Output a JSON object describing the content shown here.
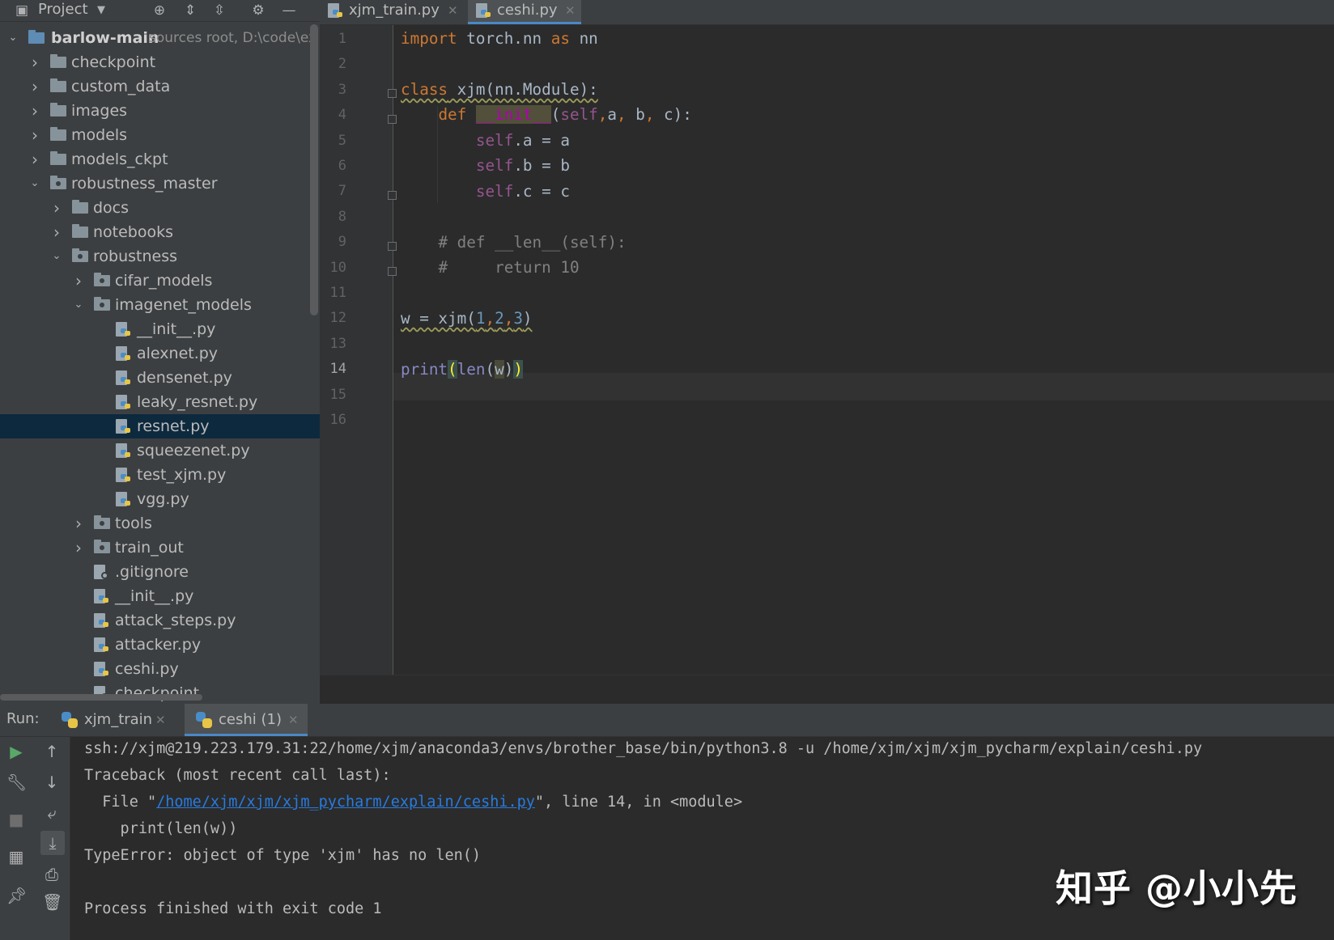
{
  "project_panel": {
    "title": "Project",
    "root": {
      "name": "barlow-main",
      "hint": "sources root,  D:\\code\\ex"
    },
    "tree": [
      {
        "label": "checkpoint",
        "type": "folder",
        "depth": 1,
        "expanded": false
      },
      {
        "label": "custom_data",
        "type": "folder",
        "depth": 1,
        "expanded": false
      },
      {
        "label": "images",
        "type": "folder",
        "depth": 1,
        "expanded": false
      },
      {
        "label": "models",
        "type": "folder",
        "depth": 1,
        "expanded": false
      },
      {
        "label": "models_ckpt",
        "type": "folder",
        "depth": 1,
        "expanded": false
      },
      {
        "label": "robustness_master",
        "type": "package",
        "depth": 1,
        "expanded": true
      },
      {
        "label": "docs",
        "type": "folder",
        "depth": 2,
        "expanded": false
      },
      {
        "label": "notebooks",
        "type": "folder",
        "depth": 2,
        "expanded": false
      },
      {
        "label": "robustness",
        "type": "package",
        "depth": 2,
        "expanded": true
      },
      {
        "label": "cifar_models",
        "type": "package",
        "depth": 3,
        "expanded": false
      },
      {
        "label": "imagenet_models",
        "type": "package",
        "depth": 3,
        "expanded": true
      },
      {
        "label": "__init__.py",
        "type": "py",
        "depth": 4
      },
      {
        "label": "alexnet.py",
        "type": "py",
        "depth": 4
      },
      {
        "label": "densenet.py",
        "type": "py",
        "depth": 4
      },
      {
        "label": "leaky_resnet.py",
        "type": "py",
        "depth": 4
      },
      {
        "label": "resnet.py",
        "type": "py",
        "depth": 4,
        "selected": true
      },
      {
        "label": "squeezenet.py",
        "type": "py",
        "depth": 4
      },
      {
        "label": "test_xjm.py",
        "type": "py",
        "depth": 4
      },
      {
        "label": "vgg.py",
        "type": "py",
        "depth": 4
      },
      {
        "label": "tools",
        "type": "package",
        "depth": 3,
        "expanded": false
      },
      {
        "label": "train_out",
        "type": "package",
        "depth": 3,
        "expanded": false
      },
      {
        "label": ".gitignore",
        "type": "git",
        "depth": 3
      },
      {
        "label": "__init__.py",
        "type": "py",
        "depth": 3
      },
      {
        "label": "attack_steps.py",
        "type": "py",
        "depth": 3
      },
      {
        "label": "attacker.py",
        "type": "py",
        "depth": 3
      },
      {
        "label": "ceshi.py",
        "type": "py",
        "depth": 3
      },
      {
        "label": "checkpoint",
        "type": "git",
        "depth": 3
      }
    ]
  },
  "editor_tabs": [
    {
      "label": "xjm_train.py",
      "active": false
    },
    {
      "label": "ceshi.py",
      "active": true
    }
  ],
  "code": {
    "current_line": 14,
    "line_numbers": [
      "1",
      "2",
      "3",
      "4",
      "5",
      "6",
      "7",
      "8",
      "9",
      "10",
      "11",
      "12",
      "13",
      "14",
      "15",
      "16"
    ]
  },
  "run_panel": {
    "label": "Run:",
    "tabs": [
      {
        "label": "xjm_train",
        "active": false
      },
      {
        "label": "ceshi (1)",
        "active": true
      }
    ],
    "console": {
      "command": "ssh://xjm@219.223.179.31:22/home/xjm/anaconda3/envs/brother_base/bin/python3.8 -u /home/xjm/xjm/xjm_pycharm/explain/ceshi.py",
      "traceback": "Traceback (most recent call last):",
      "file_prefix": "  File \"",
      "file_link": "/home/xjm/xjm/xjm_pycharm/explain/ceshi.py",
      "file_suffix": "\", line 14, in <module>",
      "code_line": "    print(len(w))",
      "error": "TypeError: object of type 'xjm' has no len()",
      "finished": "Process finished with exit code 1"
    }
  },
  "watermark": "知乎 @小小先",
  "colors": {
    "accent": "#4a88c7",
    "selection": "#0d293e",
    "keyword": "#cc7832",
    "self": "#94558d",
    "number": "#6897bb",
    "link": "#287bde"
  }
}
